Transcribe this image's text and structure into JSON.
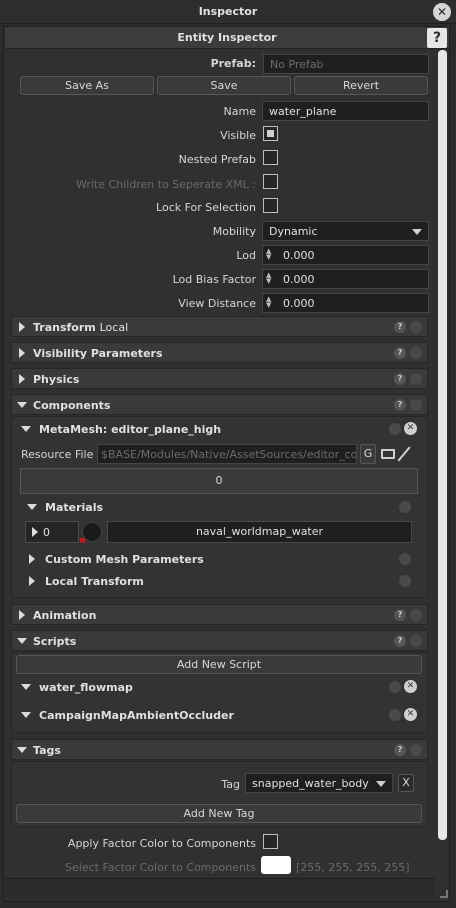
{
  "window": {
    "title": "Inspector",
    "close": "✕"
  },
  "header": {
    "title": "Entity Inspector",
    "help": "?"
  },
  "prefab": {
    "label": "Prefab:",
    "placeholder": "No Prefab"
  },
  "actions": {
    "save_as": "Save As",
    "save": "Save",
    "revert": "Revert"
  },
  "props": {
    "name_label": "Name",
    "name_value": "water_plane",
    "visible_label": "Visible",
    "visible_checked": true,
    "nested_label": "Nested Prefab",
    "write_children_label": "Write Children to Seperate XML :",
    "lock_label": "Lock For Selection",
    "mobility_label": "Mobility",
    "mobility_value": "Dynamic",
    "lod_label": "Lod",
    "lod_value": "0.000",
    "lod_bias_label": "Lod Bias Factor",
    "lod_bias_value": "0.000",
    "view_dist_label": "View Distance",
    "view_dist_value": "0.000"
  },
  "sections": {
    "transform": "Transform",
    "transform_suffix": "Local",
    "visibility": "Visibility Parameters",
    "physics": "Physics",
    "components": "Components",
    "animation": "Animation",
    "scripts": "Scripts",
    "tags": "Tags"
  },
  "q": "?",
  "x": "✕",
  "metamesh": {
    "title": "MetaMesh: editor_plane_high",
    "resource_label": "Resource File",
    "resource_value": "$BASE/Modules/Native/AssetSources/editor_conte",
    "g": "G",
    "count": "0",
    "materials_label": "Materials",
    "mat_index": "0",
    "mat_name": "naval_worldmap_water",
    "custom_mesh": "Custom Mesh Parameters",
    "local_transform": "Local Transform"
  },
  "scripts": {
    "add": "Add New Script",
    "items": [
      "water_flowmap",
      "CampaignMapAmbientOccluder"
    ]
  },
  "tags": {
    "label": "Tag",
    "value": "snapped_water_body",
    "remove": "X",
    "add": "Add New Tag"
  },
  "factor": {
    "apply_label": "Apply Factor Color to Components",
    "select_label": "Select Factor Color to Components",
    "select_value": "[255, 255, 255, 255]"
  }
}
